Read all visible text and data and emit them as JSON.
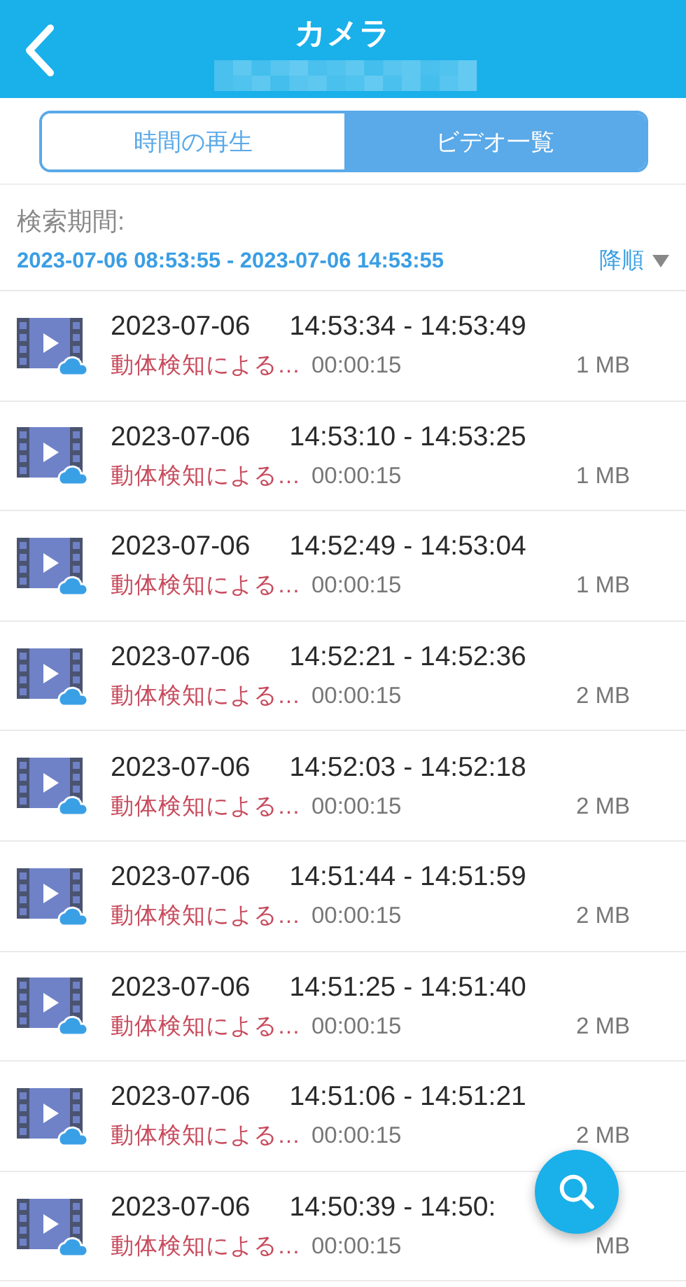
{
  "header": {
    "title": "カメラ"
  },
  "tabs": [
    {
      "label": "時間の再生",
      "selected": false
    },
    {
      "label": "ビデオ一覧",
      "selected": true
    }
  ],
  "search": {
    "label": "検索期間:",
    "range": "2023-07-06 08:53:55 - 2023-07-06 14:53:55",
    "sort": "降順"
  },
  "videos": [
    {
      "date": "2023-07-06",
      "time": "14:53:34 - 14:53:49",
      "event": "動体検知による…",
      "duration": "00:00:15",
      "size": "1 MB"
    },
    {
      "date": "2023-07-06",
      "time": "14:53:10 - 14:53:25",
      "event": "動体検知による…",
      "duration": "00:00:15",
      "size": "1 MB"
    },
    {
      "date": "2023-07-06",
      "time": "14:52:49 - 14:53:04",
      "event": "動体検知による…",
      "duration": "00:00:15",
      "size": "1 MB"
    },
    {
      "date": "2023-07-06",
      "time": "14:52:21 - 14:52:36",
      "event": "動体検知による…",
      "duration": "00:00:15",
      "size": "2 MB"
    },
    {
      "date": "2023-07-06",
      "time": "14:52:03 - 14:52:18",
      "event": "動体検知による…",
      "duration": "00:00:15",
      "size": "2 MB"
    },
    {
      "date": "2023-07-06",
      "time": "14:51:44 - 14:51:59",
      "event": "動体検知による…",
      "duration": "00:00:15",
      "size": "2 MB"
    },
    {
      "date": "2023-07-06",
      "time": "14:51:25 - 14:51:40",
      "event": "動体検知による…",
      "duration": "00:00:15",
      "size": "2 MB"
    },
    {
      "date": "2023-07-06",
      "time": "14:51:06 - 14:51:21",
      "event": "動体検知による…",
      "duration": "00:00:15",
      "size": "2 MB"
    },
    {
      "date": "2023-07-06",
      "time": "14:50:39 - 14:50:",
      "event": "動体検知による…",
      "duration": "00:00:15",
      "size": "MB"
    }
  ]
}
